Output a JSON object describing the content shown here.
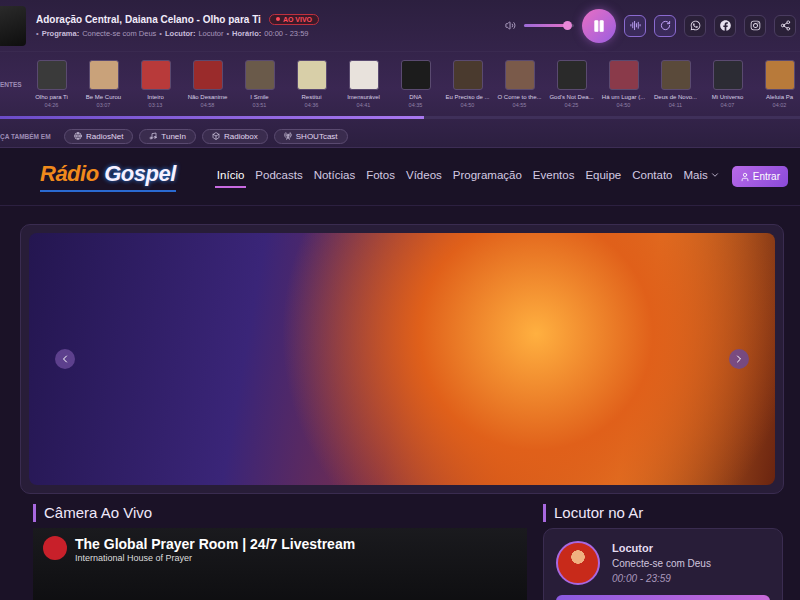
{
  "player": {
    "title": "Adoração Central, Daiana Celano - Olho para Ti",
    "badge": "AO VIVO",
    "separator": "•",
    "details": [
      {
        "label": "Programa:",
        "value": "Conecte-se com Deus"
      },
      {
        "label": "Locutor:",
        "value": "Locutor"
      },
      {
        "label": "Horário:",
        "value": "00:00 - 23:59"
      }
    ],
    "playing": true,
    "volume": {
      "level": 0.85
    }
  },
  "recent": {
    "label": "ENTES",
    "progress": {
      "level": 0.53
    },
    "tracks": [
      {
        "title": "Olho para Ti",
        "time": "04:26",
        "color": "#3a3a3a"
      },
      {
        "title": "Be Me Curou",
        "time": "03:07",
        "color": "#c9a27a"
      },
      {
        "title": "Inteiro",
        "time": "03:13",
        "color": "#b83a3a"
      },
      {
        "title": "Não Desanime",
        "time": "04:58",
        "color": "#9a2b2b"
      },
      {
        "title": "I Smile",
        "time": "03:51",
        "color": "#6a5a4a"
      },
      {
        "title": "Restitui",
        "time": "04:36",
        "color": "#d8cfa8"
      },
      {
        "title": "Imensurável",
        "time": "04:41",
        "color": "#e8e2dc"
      },
      {
        "title": "DNA",
        "time": "04:35",
        "color": "#1c1c1c"
      },
      {
        "title": "Eu Preciso de ...",
        "time": "04:50",
        "color": "#4a3a2e"
      },
      {
        "title": "O Come to the...",
        "time": "04:55",
        "color": "#7a5a4a"
      },
      {
        "title": "God's Not Dea...",
        "time": "04:25",
        "color": "#2a2a2a"
      },
      {
        "title": "Há um Lugar (...",
        "time": "04:50",
        "color": "#8a3a4a"
      },
      {
        "title": "Deus de Novo...",
        "time": "04:11",
        "color": "#5a4a3a"
      },
      {
        "title": "Mi Universo",
        "time": "04:07",
        "color": "#2c2c34"
      },
      {
        "title": "Aleluia Pa",
        "time": "04:02",
        "color": "#b87a3a"
      }
    ]
  },
  "also_on": {
    "label": "ÇA TAMBÉM EM",
    "services": [
      "RadiosNet",
      "TuneIn",
      "Radiobox",
      "SHOUTcast"
    ]
  },
  "nav": {
    "logo": {
      "first": "Rádio",
      "second": "Gospel"
    },
    "items": [
      {
        "label": "Início",
        "selected": true,
        "has_menu": false
      },
      {
        "label": "Podcasts",
        "selected": false,
        "has_menu": false
      },
      {
        "label": "Notícias",
        "selected": false,
        "has_menu": false
      },
      {
        "label": "Fotos",
        "selected": false,
        "has_menu": false
      },
      {
        "label": "Vídeos",
        "selected": false,
        "has_menu": false
      },
      {
        "label": "Programação",
        "selected": false,
        "has_menu": false
      },
      {
        "label": "Eventos",
        "selected": false,
        "has_menu": false
      },
      {
        "label": "Equipe",
        "selected": false,
        "has_menu": false
      },
      {
        "label": "Contato",
        "selected": false,
        "has_menu": false
      },
      {
        "label": "Mais",
        "selected": false,
        "has_menu": true
      }
    ],
    "login": "Entrar"
  },
  "camera": {
    "heading": "Câmera Ao Vivo",
    "video": {
      "title": "The Global Prayer Room | 24/7 Livestream",
      "channel": "International House of Prayer"
    }
  },
  "on_air": {
    "heading": "Locutor no Ar",
    "name": "Locutor",
    "program": "Conecte-se com Deus",
    "time": "00:00 - 23:59"
  }
}
